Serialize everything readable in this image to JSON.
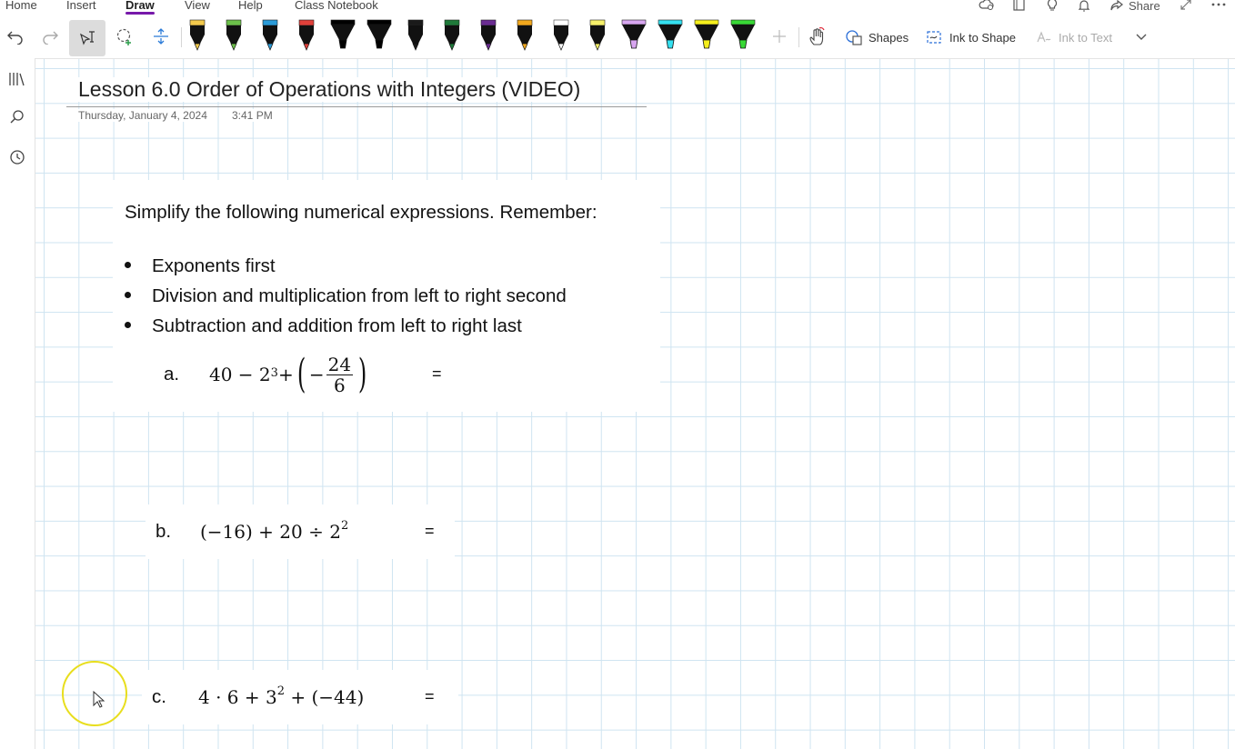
{
  "menu": {
    "tabs": [
      "Home",
      "Insert",
      "Draw",
      "View",
      "Help",
      "Class Notebook"
    ],
    "share_label": "Share"
  },
  "ribbon": {
    "shapes_label": "Shapes",
    "ink_to_shape_label": "Ink to Shape",
    "ink_to_text_label": "Ink to Text",
    "pens": [
      {
        "type": "pen",
        "color": "#f2c94c"
      },
      {
        "type": "pen",
        "color": "#6cc04a"
      },
      {
        "type": "pen",
        "color": "#2b9bd8"
      },
      {
        "type": "pen",
        "color": "#e0403a"
      },
      {
        "type": "highlighter",
        "color": "#000000"
      },
      {
        "type": "highlighter",
        "color": "#000000"
      },
      {
        "type": "pen",
        "color": "#1a1a1a"
      },
      {
        "type": "pen",
        "color": "#1f7a3a"
      },
      {
        "type": "pen",
        "color": "#6a2c91"
      },
      {
        "type": "pen",
        "color": "#f2a81d"
      },
      {
        "type": "pen",
        "color": "#ffffff"
      },
      {
        "type": "pen",
        "color": "#f6f06a"
      },
      {
        "type": "highlighter",
        "color": "#d8a6f0"
      },
      {
        "type": "highlighter",
        "color": "#34e0f0"
      },
      {
        "type": "highlighter",
        "color": "#f5ef1c"
      },
      {
        "type": "highlighter",
        "color": "#38d935"
      }
    ]
  },
  "page": {
    "title": "Lesson 6.0 Order of Operations with Integers (VIDEO)",
    "date": "Thursday, January 4, 2024",
    "time": "3:41 PM"
  },
  "content": {
    "instruction": "Simplify the following numerical expressions. Remember:",
    "bullets": [
      "Exponents first",
      "Division and multiplication from left to right second",
      "Subtraction and addition from left to right last"
    ],
    "problems": [
      {
        "label": "a.",
        "expr_prefix": "40 − 2",
        "exp": "3",
        "plus": " + ",
        "frac_num": "24",
        "frac_den": "6",
        "minus": "−",
        "equals": "="
      },
      {
        "label": "b.",
        "expr_prefix": "(−16) + 20 ÷ 2",
        "exp": "2",
        "equals": "="
      },
      {
        "label": "c.",
        "expr_prefix": "4 · 6 + 3",
        "exp": "2",
        "expr_suffix": " + (−44)",
        "equals": "="
      }
    ]
  },
  "colors": {
    "accent": "#7719aa",
    "grid": "#cfe4f1",
    "cursor_ring": "#e8de1e"
  }
}
